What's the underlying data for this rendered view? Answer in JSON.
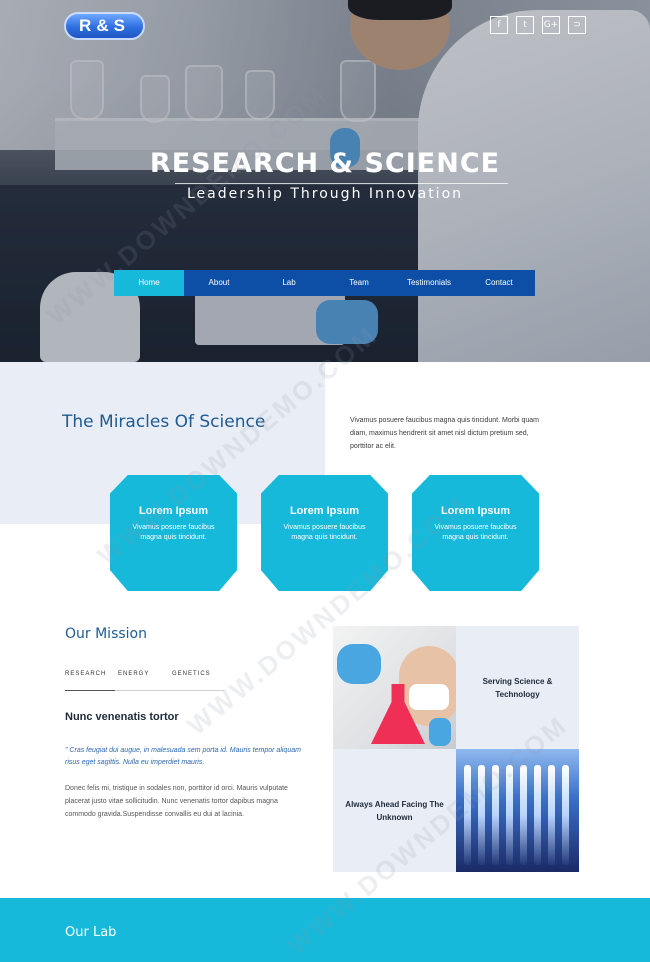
{
  "logo": {
    "text": "R&S"
  },
  "social": [
    {
      "icon": "facebook-icon",
      "glyph": "f"
    },
    {
      "icon": "twitter-icon",
      "glyph": "t"
    },
    {
      "icon": "google-plus-icon",
      "glyph": "G+"
    },
    {
      "icon": "rss-icon",
      "glyph": "⊃"
    }
  ],
  "hero": {
    "title": "RESEARCH & SCIENCE",
    "subtitle": "Leadership Through Innovation"
  },
  "nav": {
    "items": [
      "Home",
      "About",
      "Lab",
      "Team",
      "Testimonials",
      "Contact"
    ],
    "active": "Home"
  },
  "miracles": {
    "title": "The Miracles Of Science",
    "text": "Vivamus posuere faucibus magna quis tincidunt. Morbi quam diam, maximus hendrerit sit amet nisl dictum pretium sed, porttitor ac elit.",
    "cards": [
      {
        "title": "Lorem Ipsum",
        "text": "Vivamus posuere faucibus magna quis tincidunt."
      },
      {
        "title": "Lorem Ipsum",
        "text": "Vivamus posuere faucibus magna quis tincidunt."
      },
      {
        "title": "Lorem Ipsum",
        "text": "Vivamus posuere faucibus magna quis tincidunt."
      }
    ]
  },
  "mission": {
    "title": "Our Mission",
    "tabs": [
      "RESEARCH",
      "ENERGY",
      "GENETICS"
    ],
    "heading": "Nunc venenatis tortor",
    "quote": "\" Cras feugiat dui augue, in malesuada sem porta id. Mauris tempor aliquam risus eget sagittis. Nulla eu imperdiet mauris.",
    "body": "Donec felis mi, tristique in sodales non, porttitor id orci. Mauris vulputate placerat justo vitae sollicitudin. Nunc venenatis tortor dapibus magna commodo gravida.Suspendisse convallis eu dui at lacinia.",
    "tile_serving": "Serving Science & Technology",
    "tile_ahead": "Always Ahead Facing The Unknown"
  },
  "lab": {
    "title": "Our Lab"
  },
  "watermark": "WWW.DOWNDEMO.COM",
  "colors": {
    "accent": "#16b9d9",
    "nav": "#0d4ea6",
    "heading": "#1f5b93",
    "panel": "#e9edf5"
  }
}
